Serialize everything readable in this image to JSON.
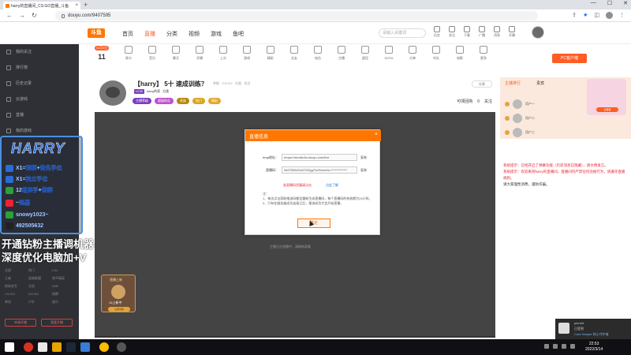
{
  "browser": {
    "tab_title": "harry的直播间_CS:GO直播_斗鱼",
    "url": "douyu.com/9407595"
  },
  "site": {
    "logo": "斗鱼",
    "nav": [
      "首页",
      "直播",
      "分类",
      "视频",
      "游戏",
      "鱼吧"
    ],
    "search_placeholder": "请输入关键词",
    "header_icons": [
      "历史",
      "关注",
      "下载",
      "广播",
      "消息",
      "开播"
    ]
  },
  "categories": {
    "first_badge": "11月3日星期一",
    "first_num": "11",
    "items": [
      "周卡",
      "音乐",
      "聊天",
      "开播",
      "上分",
      "游戏",
      "精彩",
      "交友",
      "电台",
      "主播",
      "超话",
      "DOTA",
      "大神",
      "车队",
      "电影",
      "更多"
    ]
  },
  "room": {
    "title": "【harry】 5十 速成训练？",
    "meta": "举报 · CS:GO · 分类 · 关注",
    "sub": [
      "LV30",
      "harry的家",
      "分类"
    ],
    "pills": [
      "主播等级",
      "超级粉丝",
      "贵族",
      "热门",
      "精彩"
    ],
    "share": "分享",
    "right": [
      "可领回购",
      "0",
      "关注"
    ]
  },
  "player": {
    "message": "主播正在直播中，请刷新观看",
    "mini_card": {
      "title": "直播上新",
      "sub": "13上新中",
      "btn": "立即领取"
    }
  },
  "dialog": {
    "title": "直播信息",
    "close": "×",
    "rtmp_label": "rtmp地址：",
    "rtmp_value": "rtmps://sendtc3a.douyu.com/live",
    "key_label": "直播码：",
    "key_value": "9407595rGvNTGDgpTovSecrets=*************",
    "copy": "复制",
    "warn": "若直播码泄漏请点击",
    "link": "点此了解",
    "notes": [
      "注：",
      "1、每次点击获取推流码都会重新生成直播码，每个直播码的有效期为24小时。",
      "2、只有在服务器成功连接之后，推流成功才会开始直播。"
    ],
    "ok": "确定"
  },
  "sidebar": {
    "items": [
      "我的关注",
      "排行榜",
      "历史记录",
      "云游戏",
      "直播",
      "我的游戏"
    ],
    "grid": [
      "全部",
      "热门",
      "LOL",
      "王者",
      "英雄联盟",
      "和平精英",
      "绝地求生",
      "主机",
      "DNF",
      "CS:GO",
      "DOTA2",
      "棋牌",
      "单机",
      "户外",
      "娱乐",
      "颜值",
      "舞蹈",
      "音乐"
    ],
    "btn_left": "申请开播",
    "btn_right": "我要开播"
  },
  "overlay": {
    "title": "HARRY",
    "lines": [
      "X1=观察+微先手位",
      "X1=独立手位",
      "12组赛手+微群",
      "~铭基",
      "snowy1023~",
      "492505632"
    ],
    "big1": "开通钻粉主播调机器",
    "big2": "深度优化电脑加+V"
  },
  "right_panel": {
    "pc_btn": "PC客户端",
    "tabs": [
      "主播排行",
      "贵宾"
    ],
    "cat_btn": "去看看",
    "ranks": [
      "用户一",
      "用户二",
      "用户三"
    ],
    "chat": [
      {
        "type": "sys",
        "text": "系统提示：已经开启了弹幕功能（历史消息已隐藏），请文明发言。"
      },
      {
        "type": "sys",
        "text": "系统提示：欢迎来到harry的直播间，直播间内严禁任何违规行为，请遵守直播规则。"
      },
      {
        "type": "normal",
        "text": "请大家理性消费，谨防诈骗。"
      }
    ]
  },
  "notification": {
    "line1": "pinned",
    "line2": "已签到",
    "line3": "Core Keeper 核心守护者"
  },
  "taskbar": {
    "time": "22:53",
    "date": "2022/3/14"
  },
  "colors": {
    "brand": "#ff7700",
    "accent": "#ff5d23",
    "sidebar_bg": "#2e3035",
    "overlay_blue": "#4a90e2"
  }
}
